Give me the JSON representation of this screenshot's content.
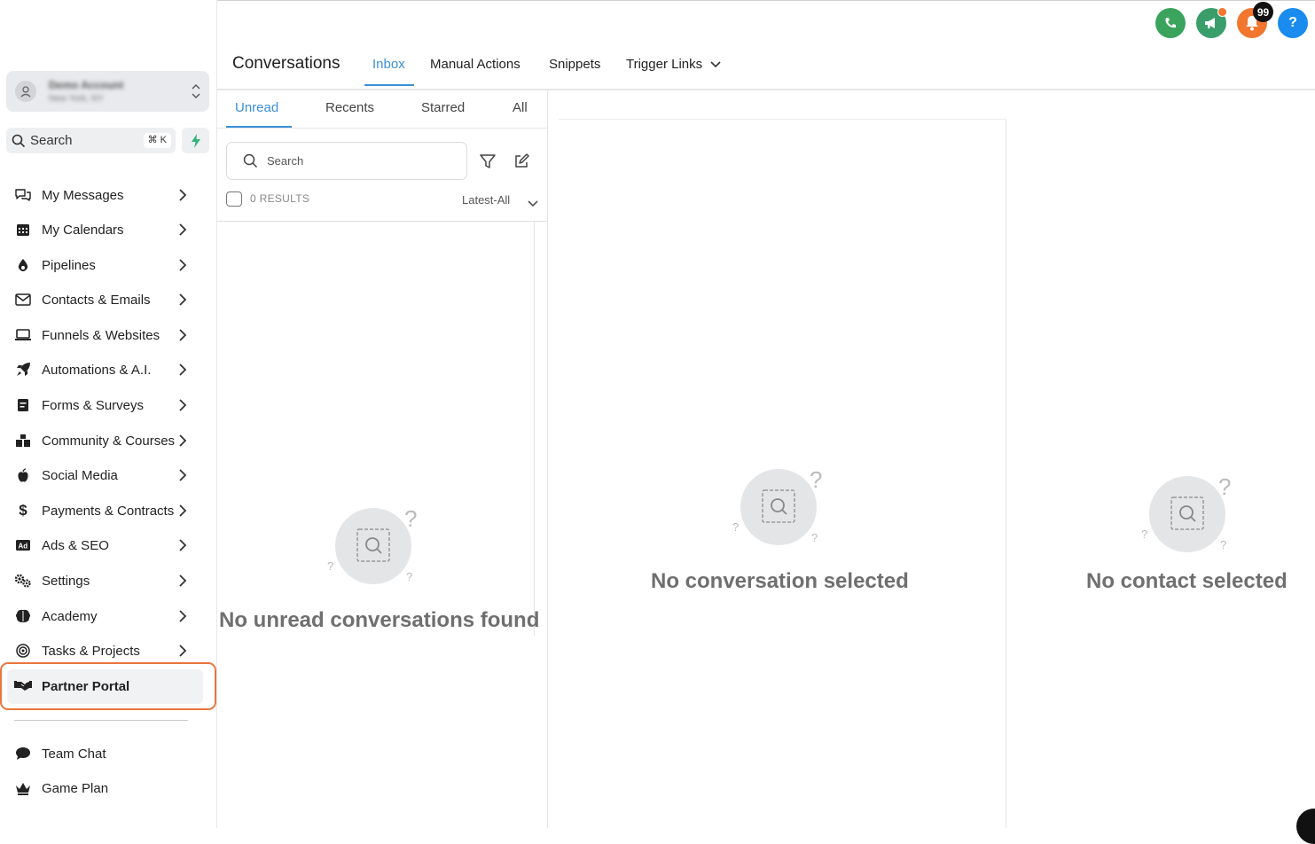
{
  "sidebar": {
    "account": {
      "name": "Demo Account",
      "location": "New York, NY"
    },
    "search": {
      "label": "Search",
      "shortcut": "⌘ K"
    },
    "items": [
      {
        "label": "My Messages",
        "icon": "chat-bubbles-icon"
      },
      {
        "label": "My Calendars",
        "icon": "calendar-icon"
      },
      {
        "label": "Pipelines",
        "icon": "funnel-drop-icon"
      },
      {
        "label": "Contacts & Emails",
        "icon": "envelope-icon"
      },
      {
        "label": "Funnels & Websites",
        "icon": "laptop-icon"
      },
      {
        "label": "Automations & A.I.",
        "icon": "rocket-icon"
      },
      {
        "label": "Forms & Surveys",
        "icon": "form-icon"
      },
      {
        "label": "Community & Courses",
        "icon": "blocks-icon"
      },
      {
        "label": "Social Media",
        "icon": "apple-icon"
      },
      {
        "label": "Payments & Contracts",
        "icon": "dollar-icon"
      },
      {
        "label": "Ads & SEO",
        "icon": "ad-icon"
      },
      {
        "label": "Settings",
        "icon": "gears-icon"
      },
      {
        "label": "Academy",
        "icon": "brain-icon"
      },
      {
        "label": "Tasks & Projects",
        "icon": "target-icon"
      }
    ],
    "partner_portal": {
      "label": "Partner Portal",
      "icon": "handshake-icon"
    },
    "bottom_items": [
      {
        "label": "Team Chat",
        "icon": "speech-bubble-icon"
      },
      {
        "label": "Game Plan",
        "icon": "crown-icon"
      }
    ]
  },
  "header": {
    "title": "Conversations",
    "tabs": [
      "Inbox",
      "Manual Actions",
      "Snippets",
      "Trigger Links"
    ],
    "active_tab": "Inbox",
    "notification_count": "99"
  },
  "list": {
    "tabs": [
      "Unread",
      "Recents",
      "Starred",
      "All"
    ],
    "active_tab": "Unread",
    "search_placeholder": "Search",
    "results": "0 RESULTS",
    "sort": "Latest-All",
    "empty_text": "No unread conversations found"
  },
  "conversation": {
    "empty_text": "No conversation selected"
  },
  "contact": {
    "empty_text": "No contact selected"
  },
  "colors": {
    "accent": "#3b8fd8",
    "green": "#3aa35c",
    "orange": "#f2762e",
    "blue": "#1a8cf0",
    "highlight": "#e8763f"
  }
}
